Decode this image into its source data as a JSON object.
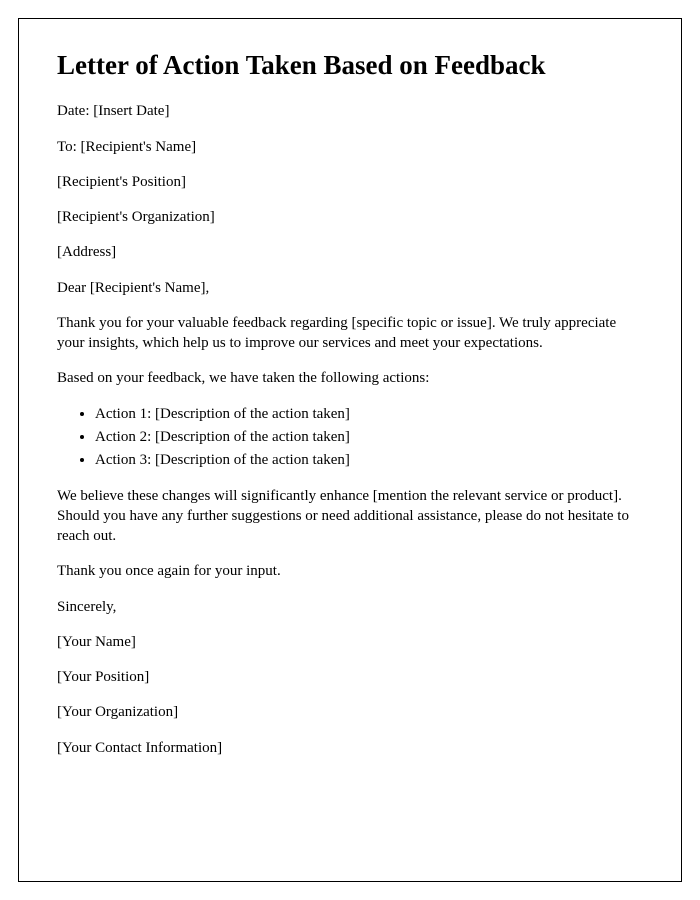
{
  "title": "Letter of Action Taken Based on Feedback",
  "date_line": "Date: [Insert Date]",
  "to_line": "To: [Recipient's Name]",
  "recipient_position": "[Recipient's Position]",
  "recipient_organization": "[Recipient's Organization]",
  "address": "[Address]",
  "salutation": "Dear [Recipient's Name],",
  "intro_paragraph": "Thank you for your valuable feedback regarding [specific topic or issue]. We truly appreciate your insights, which help us to improve our services and meet your expectations.",
  "actions_intro": "Based on your feedback, we have taken the following actions:",
  "actions": [
    "Action 1: [Description of the action taken]",
    "Action 2: [Description of the action taken]",
    "Action 3: [Description of the action taken]"
  ],
  "closing_paragraph": "We believe these changes will significantly enhance [mention the relevant service or product]. Should you have any further suggestions or need additional assistance, please do not hesitate to reach out.",
  "thanks": "Thank you once again for your input.",
  "signoff": "Sincerely,",
  "your_name": "[Your Name]",
  "your_position": "[Your Position]",
  "your_organization": "[Your Organization]",
  "your_contact": "[Your Contact Information]"
}
